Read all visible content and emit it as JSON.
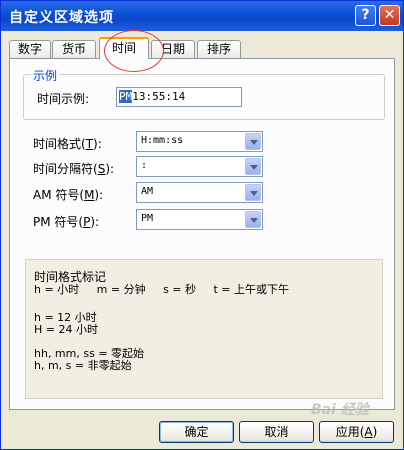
{
  "window": {
    "title": "自定义区域选项",
    "help_glyph": "?",
    "close_glyph": "✕"
  },
  "tabs": [
    {
      "label": "数字",
      "active": false
    },
    {
      "label": "货币",
      "active": false
    },
    {
      "label": "时间",
      "active": true
    },
    {
      "label": "日期",
      "active": false
    },
    {
      "label": "排序",
      "active": false
    }
  ],
  "sample": {
    "group_label": "示例",
    "field_label": "时间示例:",
    "value_highlight": "PM",
    "value_rest": "13:55:14"
  },
  "fields": [
    {
      "label_pre": "时间格式(",
      "accel": "T",
      "label_post": "):",
      "value": "H:mm:ss"
    },
    {
      "label_pre": "时间分隔符(",
      "accel": "S",
      "label_post": "):",
      "value": ":"
    },
    {
      "label_pre": "AM 符号(",
      "accel": "M",
      "label_post": "):",
      "value": "AM"
    },
    {
      "label_pre": "PM 符号(",
      "accel": "P",
      "label_post": "):",
      "value": "PM"
    }
  ],
  "notation": {
    "heading": "时间格式标记",
    "line1": "h = 小时     m = 分钟     s = 秒     t = 上午或下午",
    "line2": "h = 12 小时",
    "line3": "H = 24 小时",
    "line4": "hh, mm, ss = 零起始",
    "line5": "h, m, s = 非零起始"
  },
  "buttons": {
    "ok": "确定",
    "cancel": "取消",
    "apply_pre": "应用(",
    "apply_accel": "A",
    "apply_post": ")"
  },
  "watermark": "Bai 经验"
}
